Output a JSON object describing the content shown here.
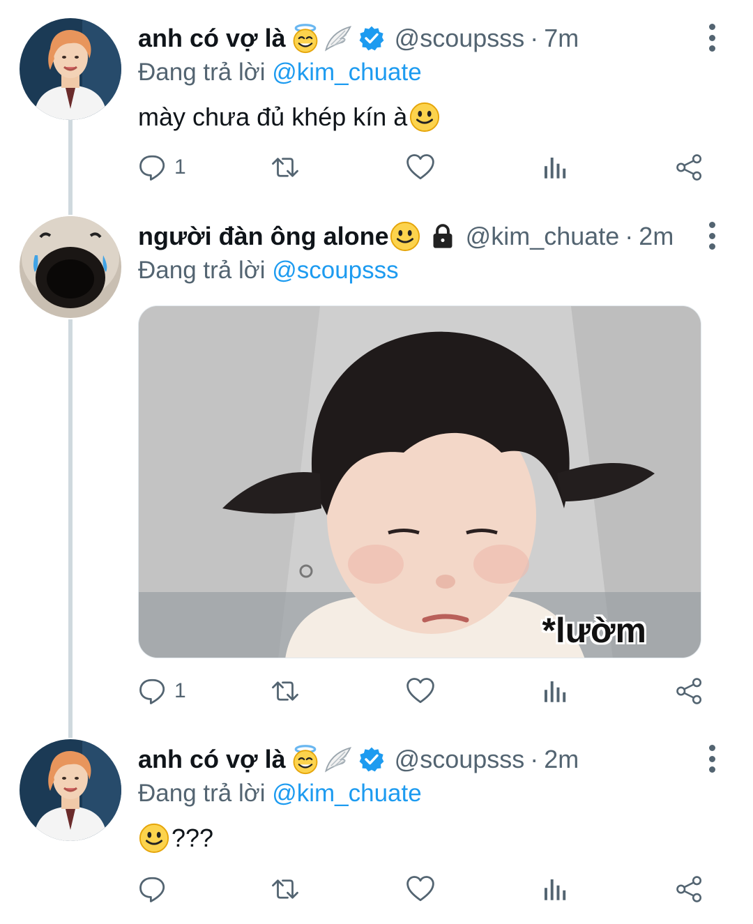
{
  "tweets": [
    {
      "name": "anh có vợ là",
      "handle": "@scoupsss",
      "separator": "·",
      "time": "7m",
      "replying_prefix": "Đang trả lời",
      "replying_to": "@kim_chuate",
      "text": "mày chưa đủ khép kín à",
      "reply_count": "1",
      "verified": true
    },
    {
      "name": "người đàn ông alone",
      "handle": "@kim_chuate",
      "separator": "·",
      "time": "2m",
      "replying_prefix": "Đang trả lời",
      "replying_to": "@scoupsss",
      "media_caption": "*lườm",
      "reply_count": "1",
      "locked": true
    },
    {
      "name": "anh có vợ là",
      "handle": "@scoupsss",
      "separator": "·",
      "time": "2m",
      "replying_prefix": "Đang trả lời",
      "replying_to": "@kim_chuate",
      "text": "???",
      "reply_count": "",
      "verified": true
    }
  ],
  "colors": {
    "accent": "#1d9bf0",
    "secondary_text": "#536471",
    "primary_text": "#0f1419",
    "thread_line": "#cfd9de"
  },
  "icons": [
    "reply-icon",
    "retweet-icon",
    "like-icon",
    "analytics-icon",
    "share-icon",
    "more-icon",
    "verified-badge-icon",
    "lock-icon",
    "halo-emoji-icon",
    "wing-emoji-icon",
    "smile-emoji-icon"
  ]
}
